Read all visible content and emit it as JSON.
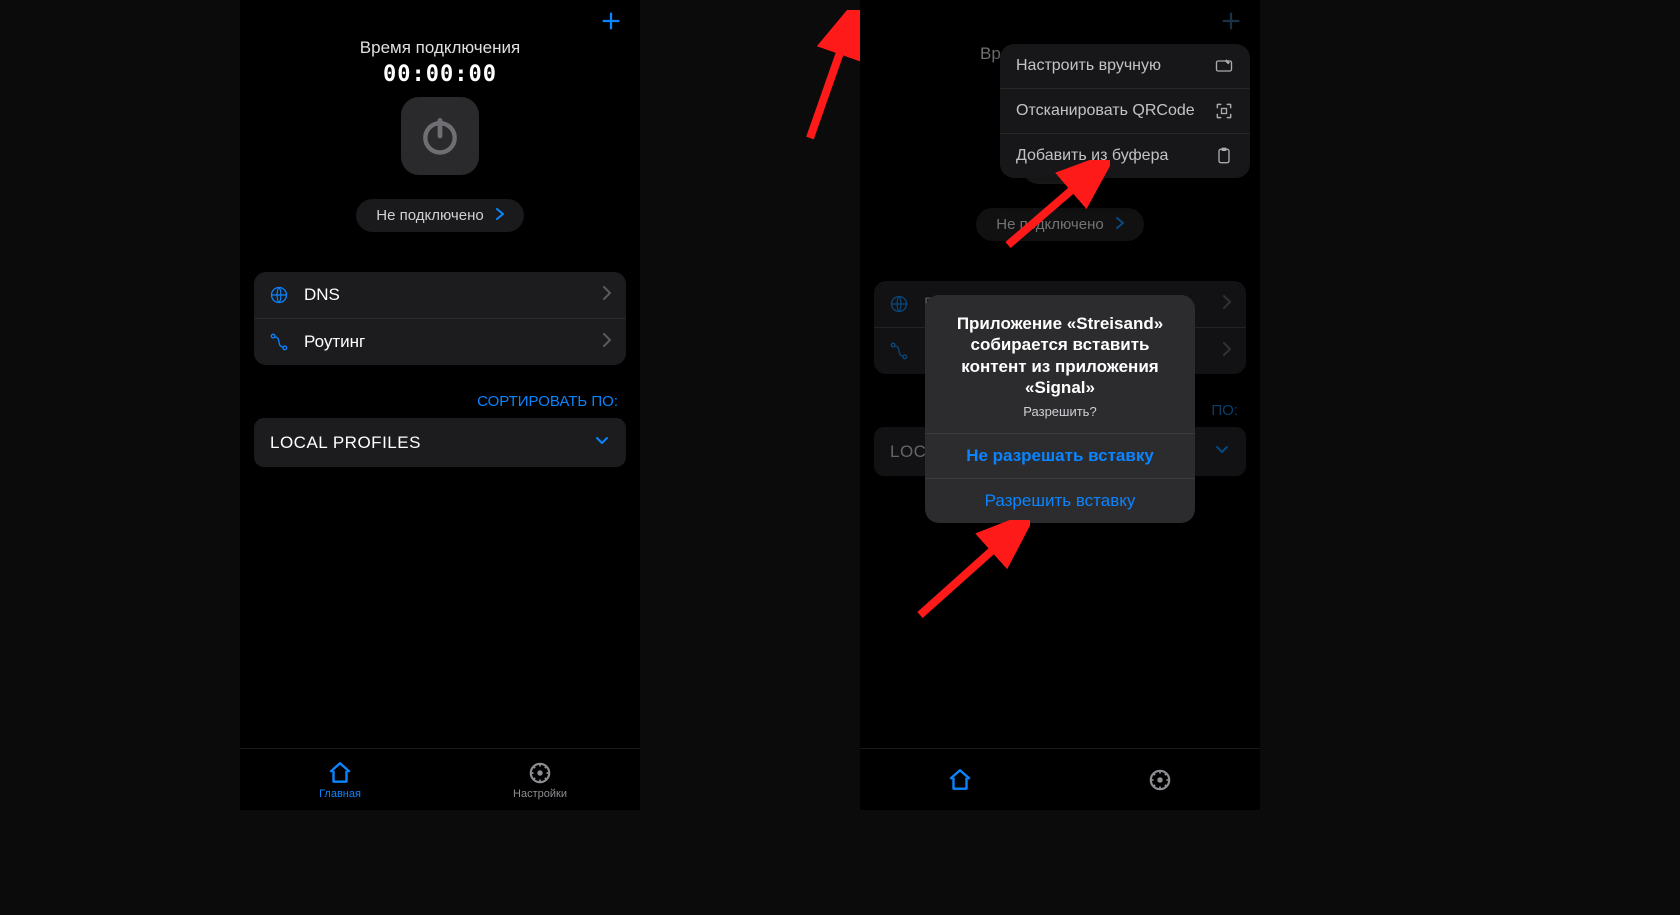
{
  "left": {
    "timer_label": "Время подключения",
    "timer_value": "00:00:00",
    "status_text": "Не  подключено",
    "rows": {
      "dns": "DNS",
      "routing": "Роутинг"
    },
    "sort_label": "СОРТИРОВАТЬ ПО:",
    "profiles_label": "LOCAL PROFILES",
    "tabs": {
      "home": "Главная",
      "settings": "Настройки"
    }
  },
  "right": {
    "timer_label_trunc": "Вре",
    "status_text": "Не  подключено",
    "rows_trunc": {
      "dns": "D",
      "routing": "Р"
    },
    "sort_trunc": " ПО:",
    "profiles_trunc": "LOC",
    "popup": {
      "manual": "Настроить вручную",
      "scan_qr": "Отсканировать QRCode",
      "paste": "Добавить из буфера"
    },
    "dialog": {
      "message": "Приложение «Streisand» собирается вставить контент из приложения «Signal»",
      "sub": "Разрешить?",
      "deny": "Не разрешать вставку",
      "allow": "Разрешить вставку"
    }
  }
}
